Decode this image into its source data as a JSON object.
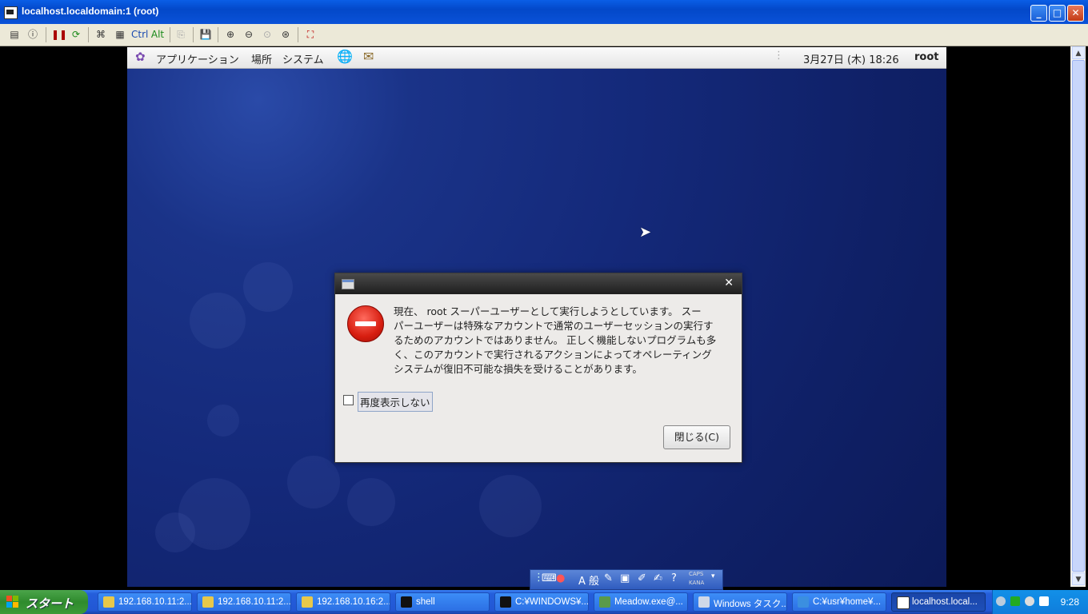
{
  "vnc_window": {
    "title": "localhost.localdomain:1 (root)",
    "minimize": "_",
    "maximize": "□",
    "close": "✕"
  },
  "toolbar": {
    "ctrl_label": "Ctrl",
    "alt_label": "Alt"
  },
  "gnome_panel": {
    "menu_applications": "アプリケーション",
    "menu_places": "場所",
    "menu_system": "システム",
    "clock": "3月27日 (木) 18:26",
    "user": "root"
  },
  "dialog": {
    "close_glyph": "✕",
    "message_lines": [
      "現在、 root スーパーユーザーとして実行しようとしています。 スー",
      "パーユーザーは特殊なアカウントで通常のユーザーセッションの実行す",
      "るためのアカウントではありません。 正しく機能しないプログラムも多",
      "く、このアカウントで実行されるアクションによってオペレーティング",
      "システムが復旧不可能な損失を受けることがあります。"
    ],
    "dont_show_label": "再度表示しない",
    "dont_show_checked": false,
    "close_button": "閉じる(C)"
  },
  "ime_bar": {
    "mode": "A 般",
    "caps": "CAPS",
    "kana": "KANA"
  },
  "taskbar": {
    "start_label": "スタート",
    "tasks": [
      {
        "label": "192.168.10.11:2...",
        "icon": "vnc-viewer-icon",
        "color": "#e8c84a"
      },
      {
        "label": "192.168.10.11:2...",
        "icon": "vnc-viewer-icon",
        "color": "#e8c84a"
      },
      {
        "label": "192.168.10.16:2...",
        "icon": "vnc-viewer-icon",
        "color": "#e8c84a"
      },
      {
        "label": "shell",
        "icon": "command-prompt-icon",
        "color": "#111111"
      },
      {
        "label": "C:¥WINDOWS¥...",
        "icon": "command-prompt-icon",
        "color": "#111111"
      },
      {
        "label": "Meadow.exe@...",
        "icon": "meadow-icon",
        "color": "#5a9a4a"
      },
      {
        "label": "Windows タスク...",
        "icon": "task-manager-icon",
        "color": "#cfd8e8"
      },
      {
        "label": "C:¥usr¥home¥...",
        "icon": "ie-icon",
        "color": "#3b8fe0"
      },
      {
        "label": "localhost.local...",
        "icon": "vnc-viewer-icon",
        "color": "#ffffff",
        "active": true
      }
    ],
    "clock": "9:28"
  }
}
